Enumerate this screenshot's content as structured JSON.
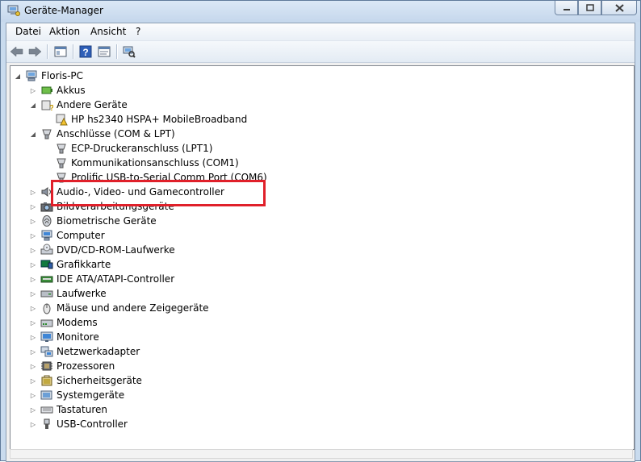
{
  "window": {
    "title": "Geräte-Manager"
  },
  "menu": [
    "Datei",
    "Aktion",
    "Ansicht",
    "?"
  ],
  "toolbar": {
    "buttons": [
      "back-arrow-icon",
      "forward-arrow-icon",
      "show-hide-console-tree-icon",
      "help-icon",
      "properties-icon",
      "scan-hardware-icon"
    ]
  },
  "tree": {
    "root": "Floris-PC",
    "items": [
      {
        "label": "Akkus",
        "icon": "battery-icon",
        "level": 1,
        "expanded": false
      },
      {
        "label": "Andere Geräte",
        "icon": "unknown-device-icon",
        "level": 1,
        "expanded": true
      },
      {
        "label": "HP hs2340 HSPA+ MobileBroadband",
        "icon": "warning-device-icon",
        "level": 2
      },
      {
        "label": "Anschlüsse (COM & LPT)",
        "icon": "port-icon",
        "level": 1,
        "expanded": true
      },
      {
        "label": "ECP-Druckeranschluss (LPT1)",
        "icon": "port-icon",
        "level": 2
      },
      {
        "label": "Kommunikationsanschluss (COM1)",
        "icon": "port-icon",
        "level": 2
      },
      {
        "label": "Prolific USB-to-Serial Comm Port (COM6)",
        "icon": "port-icon",
        "level": 2
      },
      {
        "label": "Audio-, Video- und Gamecontroller",
        "icon": "speaker-icon",
        "level": 1,
        "expanded": false
      },
      {
        "label": "Bildverarbeitungsgeräte",
        "icon": "camera-icon",
        "level": 1,
        "expanded": false
      },
      {
        "label": "Biometrische Geräte",
        "icon": "fingerprint-icon",
        "level": 1,
        "expanded": false
      },
      {
        "label": "Computer",
        "icon": "computer-icon",
        "level": 1,
        "expanded": false
      },
      {
        "label": "DVD/CD-ROM-Laufwerke",
        "icon": "dvd-icon",
        "level": 1,
        "expanded": false
      },
      {
        "label": "Grafikkarte",
        "icon": "display-adapter-icon",
        "level": 1,
        "expanded": false
      },
      {
        "label": "IDE ATA/ATAPI-Controller",
        "icon": "ide-controller-icon",
        "level": 1,
        "expanded": false
      },
      {
        "label": "Laufwerke",
        "icon": "disk-drive-icon",
        "level": 1,
        "expanded": false
      },
      {
        "label": "Mäuse und andere Zeigegeräte",
        "icon": "mouse-icon",
        "level": 1,
        "expanded": false
      },
      {
        "label": "Modems",
        "icon": "modem-icon",
        "level": 1,
        "expanded": false
      },
      {
        "label": "Monitore",
        "icon": "monitor-icon",
        "level": 1,
        "expanded": false
      },
      {
        "label": "Netzwerkadapter",
        "icon": "network-adapter-icon",
        "level": 1,
        "expanded": false
      },
      {
        "label": "Prozessoren",
        "icon": "processor-icon",
        "level": 1,
        "expanded": false
      },
      {
        "label": "Sicherheitsgeräte",
        "icon": "security-device-icon",
        "level": 1,
        "expanded": false
      },
      {
        "label": "Systemgeräte",
        "icon": "system-device-icon",
        "level": 1,
        "expanded": false
      },
      {
        "label": "Tastaturen",
        "icon": "keyboard-icon",
        "level": 1,
        "expanded": false
      },
      {
        "label": "USB-Controller",
        "icon": "usb-icon",
        "level": 1,
        "expanded": false
      }
    ]
  },
  "highlight_color": "#e0202a"
}
